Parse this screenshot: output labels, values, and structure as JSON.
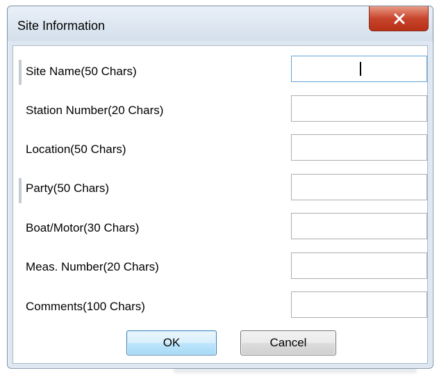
{
  "window": {
    "title": "Site Information"
  },
  "fields": [
    {
      "label": "Site Name(50 Chars)",
      "value": "",
      "focused": true
    },
    {
      "label": "Station Number(20 Chars)",
      "value": ""
    },
    {
      "label": "Location(50 Chars)",
      "value": ""
    },
    {
      "label": "Party(50 Chars)",
      "value": ""
    },
    {
      "label": "Boat/Motor(30 Chars)",
      "value": ""
    },
    {
      "label": "Meas. Number(20 Chars)",
      "value": ""
    },
    {
      "label": "Comments(100 Chars)",
      "value": ""
    }
  ],
  "buttons": {
    "ok_label": "OK",
    "cancel_label": "Cancel"
  },
  "colors": {
    "close_button": "#c8452d",
    "focus_border": "#5fa3d8",
    "ok_border": "#3c7fb1"
  },
  "icons": {
    "close": "close-x-icon"
  }
}
